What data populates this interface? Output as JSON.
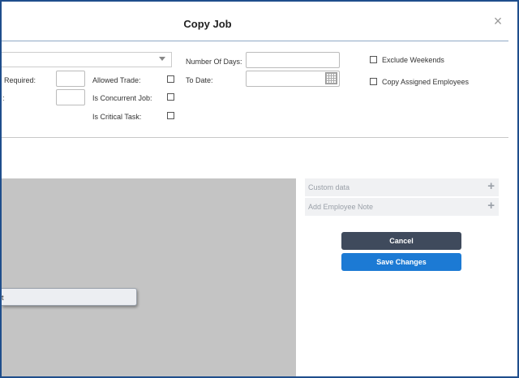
{
  "dialog": {
    "title": "Copy Job",
    "close_symbol": "×"
  },
  "form": {
    "crew_required_label": "Required:",
    "second_field_label": ":",
    "allowed_trade_label": "Allowed Trade:",
    "is_concurrent_job_label": "Is Concurrent Job:",
    "is_critical_task_label": "Is Critical Task:",
    "number_of_days_label": "Number Of Days:",
    "to_date_label": "To Date:",
    "exclude_weekends_label": "Exclude Weekends",
    "copy_assigned_employees_label": "Copy Assigned Employees"
  },
  "panel": {
    "floating_button_label": "t"
  },
  "sidebar": {
    "custom_data_label": "Custom data",
    "add_employee_note_label": "Add Employee Note",
    "plus_symbol": "+"
  },
  "actions": {
    "cancel_label": "Cancel",
    "save_changes_label": "Save Changes"
  },
  "colors": {
    "frame_border": "#1f4e8c",
    "cancel_bg": "#3f4a5c",
    "save_bg": "#1c7ad4",
    "gray_panel": "#c4c4c4"
  }
}
